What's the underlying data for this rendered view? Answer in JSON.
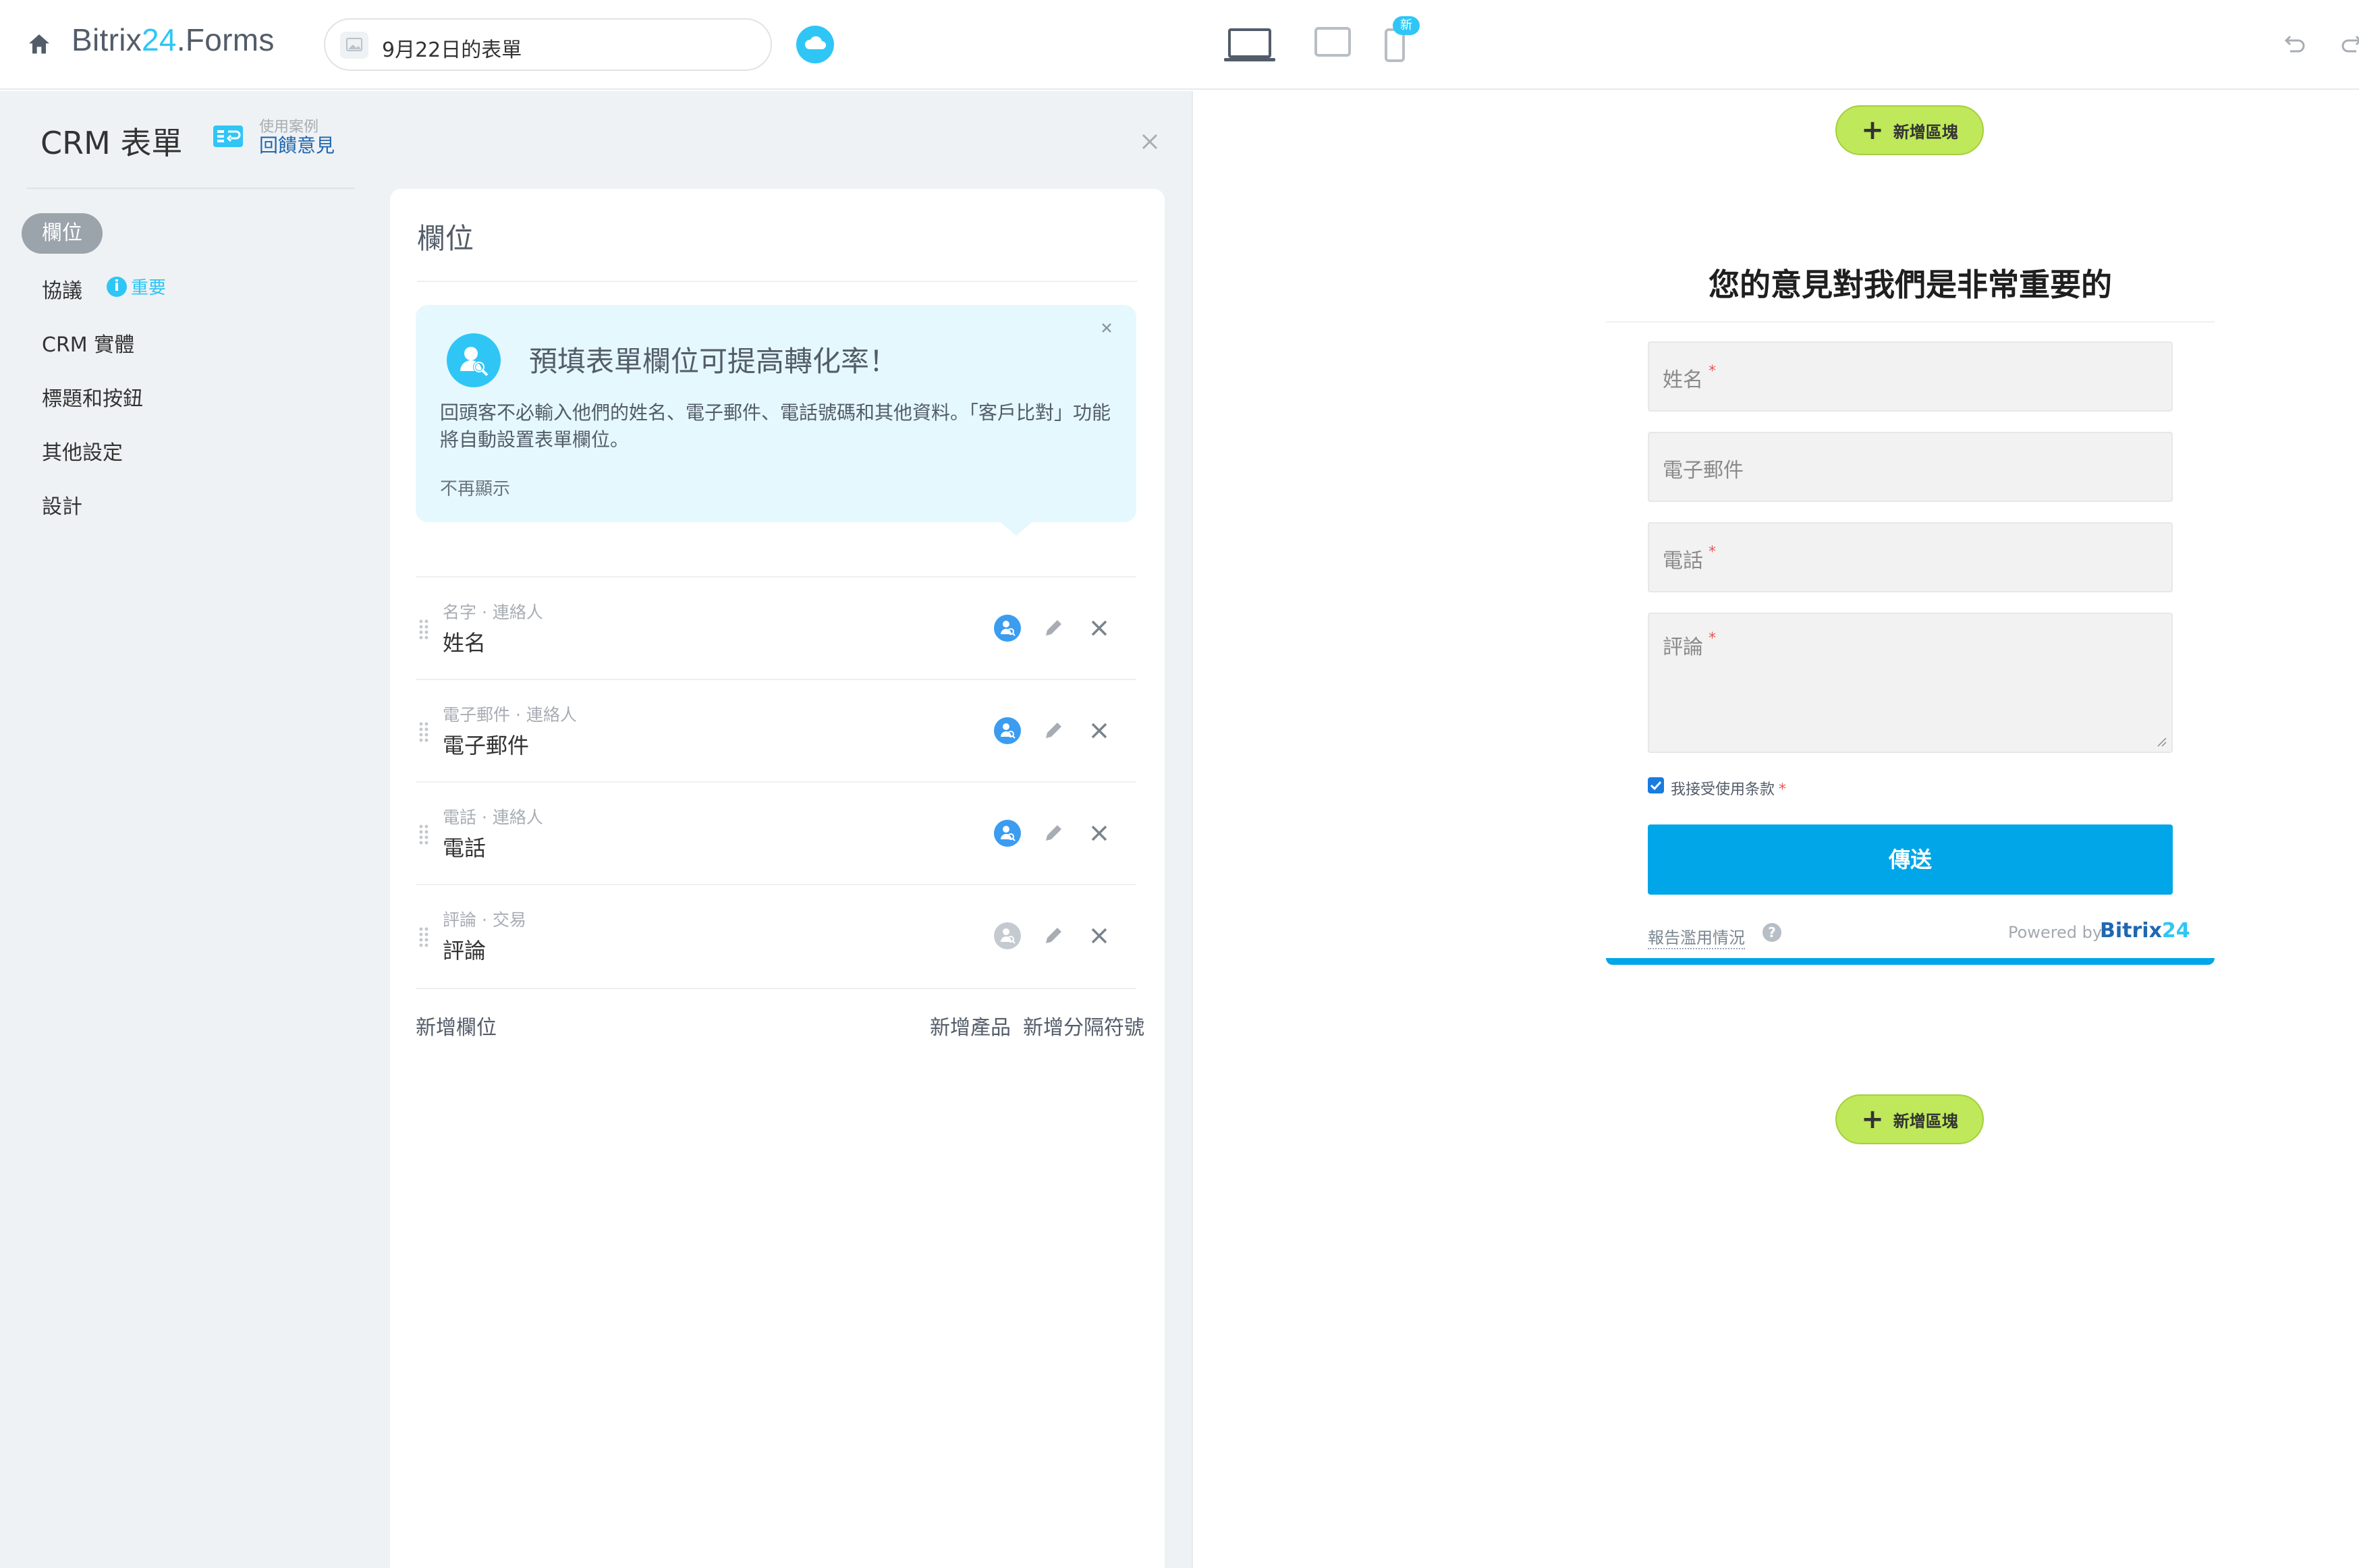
{
  "header": {
    "brand_main": "Bitrix",
    "brand_num": "24",
    "brand_suffix": ".Forms",
    "form_name": "9月22日的表單",
    "new_badge": "新"
  },
  "sidebar": {
    "title": "CRM 表單",
    "usecase_caption": "使用案例",
    "usecase_link": "回饋意見",
    "important_badge": "重要",
    "items": [
      {
        "label": "欄位",
        "active": true
      },
      {
        "label": "協議"
      },
      {
        "label": "CRM 實體"
      },
      {
        "label": "標題和按鈕"
      },
      {
        "label": "其他設定"
      },
      {
        "label": "設計"
      }
    ]
  },
  "fields_panel": {
    "heading": "欄位",
    "promo": {
      "title": "預填表單欄位可提高轉化率！",
      "body": "回頭客不必輸入他們的姓名、電子郵件、電話號碼和其他資料。「客戶比對」功能將自動設置表單欄位。",
      "dismiss": "不再顯示"
    },
    "fields": [
      {
        "caption": "名字 · 連絡人",
        "label": "姓名",
        "crm_linked": true
      },
      {
        "caption": "電子郵件 · 連絡人",
        "label": "電子郵件",
        "crm_linked": true
      },
      {
        "caption": "電話 · 連絡人",
        "label": "電話",
        "crm_linked": true
      },
      {
        "caption": "評論 · 交易",
        "label": "評論",
        "crm_linked": false
      }
    ],
    "add_field": "新增欄位",
    "add_product": "新增產品",
    "add_separator": "新增分隔符號"
  },
  "preview": {
    "add_block_label": "新增區塊",
    "title": "您的意見對我們是非常重要的",
    "inputs": {
      "name": "姓名",
      "email": "電子郵件",
      "phone": "電話",
      "comment": "評論"
    },
    "required_mark": "*",
    "agreement": "我接受使用条款",
    "agreement_checked": true,
    "send": "傳送",
    "report": "報告濫用情況",
    "help": "?",
    "powered_by": "Powered by",
    "powered_brand": "Bitrix",
    "powered_num": "24"
  },
  "colors": {
    "accent": "#2fc6f6",
    "send_button": "#00a6e8",
    "add_block": "#bfe85a",
    "sidebar_bg": "#eef2f4",
    "promo_bg": "#e5f8fd"
  }
}
